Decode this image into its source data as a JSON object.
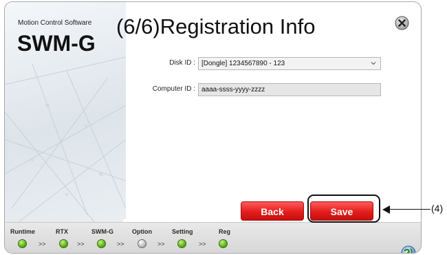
{
  "brand": {
    "subtitle": "Motion Control Software",
    "name": "SWM-G"
  },
  "page": {
    "title": "(6/6)Registration Info"
  },
  "form": {
    "disk_id_label": "Disk ID :",
    "disk_id_value": "[Dongle] 1234567890 - 123",
    "computer_id_label": "Computer ID :",
    "computer_id_value": "aaaa-ssss-yyyy-zzzz"
  },
  "buttons": {
    "back": "Back",
    "save": "Save"
  },
  "annotation": {
    "label": "(4)"
  },
  "steps": [
    {
      "label": "Runtime",
      "status": "done"
    },
    {
      "label": "RTX",
      "status": "done"
    },
    {
      "label": "SWM-G",
      "status": "done"
    },
    {
      "label": "Option",
      "status": "skipped"
    },
    {
      "label": "Setting",
      "status": "done"
    },
    {
      "label": "Reg",
      "status": "done"
    }
  ],
  "step_separator": ">>",
  "colors": {
    "accent_red": "#e21d1d",
    "step_done": "#61b81f",
    "step_skipped": "#bdbdbd"
  },
  "icons": {
    "close": "close-circle-icon",
    "globe": "globe-icon",
    "dropdown": "chevron-down-icon"
  }
}
